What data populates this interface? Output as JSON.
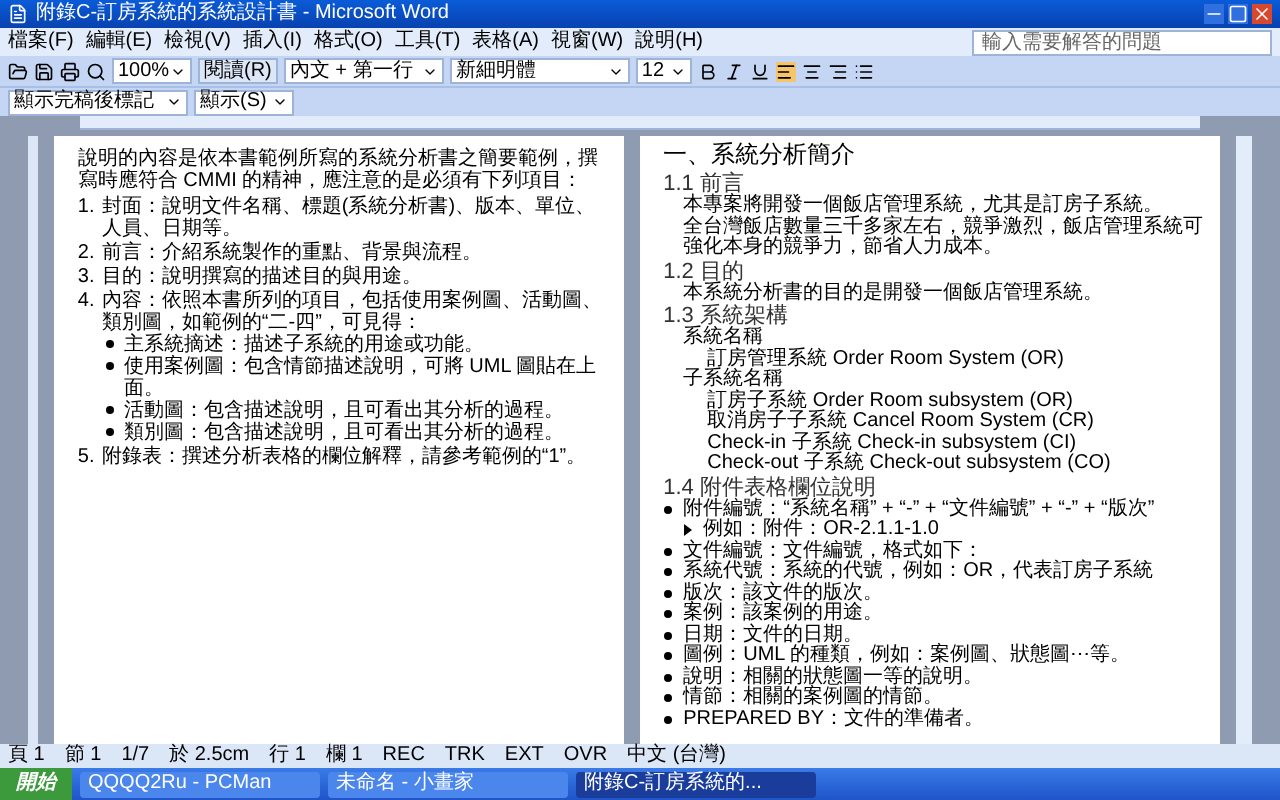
{
  "window": {
    "title": "附錄C-訂房系統的系統設計書 - Microsoft Word"
  },
  "menu": [
    "檔案(F)",
    "編輯(E)",
    "檢視(V)",
    "插入(I)",
    "格式(O)",
    "工具(T)",
    "表格(A)",
    "視窗(W)",
    "說明(H)"
  ],
  "help_box": {
    "placeholder": "輸入需要解答的問題"
  },
  "toolbar": {
    "zoom": "100%",
    "read_button": "閱讀(R)",
    "style": "內文 + 第一行",
    "font": "新細明體",
    "size": "12"
  },
  "review_toolbar": {
    "view": "顯示完稿後標記",
    "show": "顯示(S)"
  },
  "left_page": {
    "intro": "說明的內容是依本書範例所寫的系統分析書之簡要範例，撰寫時應符合 CMMI 的精神，應注意的是必須有下列項目：",
    "items": [
      {
        "marker": "1.",
        "text": "封面：說明文件名稱、標題(系統分析書)、版本、單位、人員、日期等。"
      },
      {
        "marker": "2.",
        "text": "前言：介紹系統製作的重點、背景與流程。"
      },
      {
        "marker": "3.",
        "text": "目的：說明撰寫的描述目的與用途。"
      },
      {
        "marker": "4.",
        "text": "內容：依照本書所列的項目，包括使用案例圖、活動圖、類別圖，如範例的“二-四”，可見得：",
        "bullets": [
          "主系統摘述：描述子系統的用途或功能。",
          "使用案例圖：包含情節描述說明，可將 UML 圖貼在上面。",
          "活動圖：包含描述說明，且可看出其分析的過程。",
          "類別圖：包含描述說明，且可看出其分析的過程。"
        ]
      },
      {
        "marker": "5.",
        "text": "附錄表：撰述分析表格的欄位解釋，請參考範例的“1”。"
      }
    ]
  },
  "right_page": [
    {
      "kind": "h1",
      "text": "一、系統分析簡介"
    },
    {
      "kind": "h2",
      "text": "1.1 前言"
    },
    {
      "kind": "para",
      "text": "本專案將開發一個飯店管理系統，尤其是訂房子系統。"
    },
    {
      "kind": "para",
      "text": "全台灣飯店數量三千多家左右，競爭激烈，飯店管理系統可強化本身的競爭力，節省人力成本。"
    },
    {
      "kind": "h2",
      "text": "1.2 目的"
    },
    {
      "kind": "para",
      "text": "本系統分析書的目的是開發一個飯店管理系統。"
    },
    {
      "kind": "h2",
      "text": "1.3 系統架構"
    },
    {
      "kind": "para",
      "text": "系統名稱"
    },
    {
      "kind": "indent",
      "text": "訂房管理系統 Order Room System (OR)"
    },
    {
      "kind": "para",
      "text": "子系統名稱"
    },
    {
      "kind": "indent",
      "text": "訂房子系統 Order Room subsystem (OR)"
    },
    {
      "kind": "indent",
      "text": "取消房子子系統 Cancel Room System (CR)"
    },
    {
      "kind": "indent",
      "text": "Check-in 子系統 Check-in subsystem (CI)"
    },
    {
      "kind": "indent",
      "text": "Check-out 子系統 Check-out subsystem (CO)"
    },
    {
      "kind": "h2",
      "text": "1.4 附件表格欄位說明"
    },
    {
      "kind": "bullet",
      "text": "附件編號：“系統名稱” + “-” + “文件編號” + “-” + “版次”"
    },
    {
      "kind": "sub",
      "text": "例如：附件：OR-2.1.1-1.0"
    },
    {
      "kind": "bullet",
      "text": "文件編號：文件編號，格式如下："
    },
    {
      "kind": "bullet",
      "text": "系統代號：系統的代號，例如：OR，代表訂房子系統"
    },
    {
      "kind": "bullet",
      "text": "版次：該文件的版次。"
    },
    {
      "kind": "bullet",
      "text": "案例：該案例的用途。"
    },
    {
      "kind": "bullet",
      "text": "日期：文件的日期。"
    },
    {
      "kind": "bullet",
      "text": "圖例：UML 的種類，例如：案例圖、狀態圖⋯等。"
    },
    {
      "kind": "bullet",
      "text": "說明：相關的狀態圖一等的說明。"
    },
    {
      "kind": "bullet",
      "text": "情節：相關的案例圖的情節。"
    },
    {
      "kind": "bullet",
      "text": "PREPARED BY：文件的準備者。"
    }
  ],
  "status_bar": [
    "頁 1",
    "節 1",
    "1/7",
    "於 2.5cm",
    "行 1",
    "欄 1",
    "REC",
    "TRK",
    "EXT",
    "OVR",
    "中文 (台灣)"
  ],
  "taskbar": {
    "start": "開始",
    "tasks": [
      {
        "label": "QQQQ2Ru - PCMan",
        "selected": false
      },
      {
        "label": "未命名 - 小畫家",
        "selected": false
      },
      {
        "label": "附錄C-訂房系統的...",
        "selected": true
      }
    ]
  }
}
